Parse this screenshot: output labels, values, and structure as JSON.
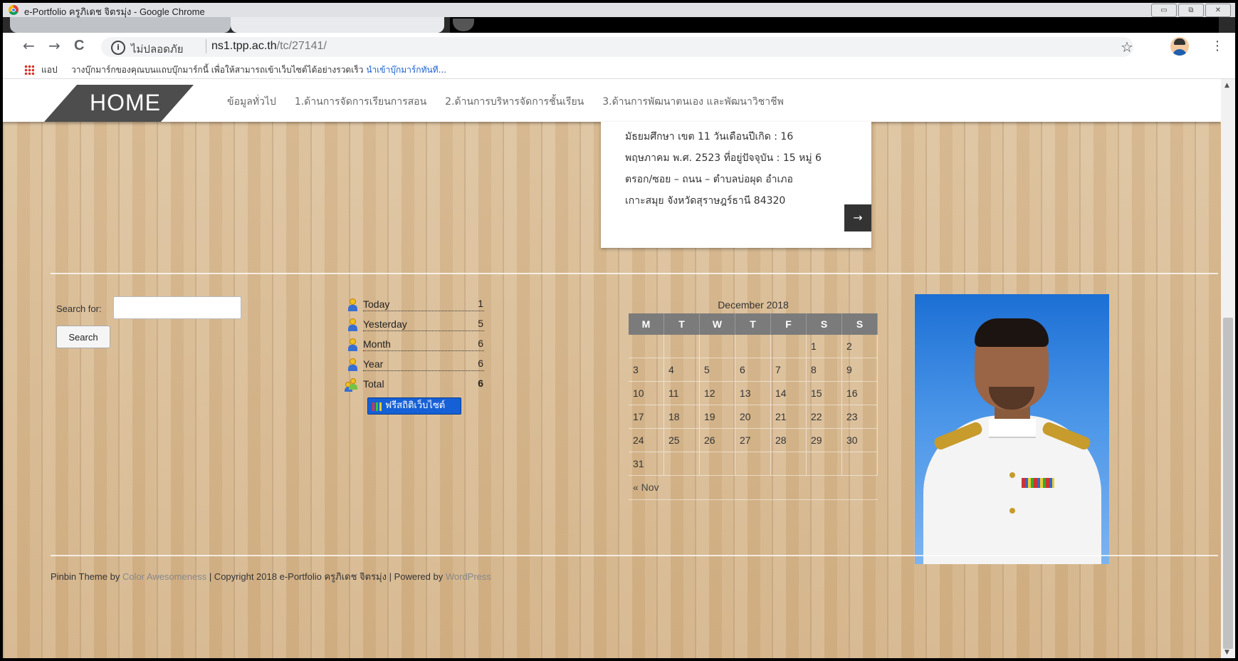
{
  "window": {
    "title": "e-Portfolio ครูภิเดช จิตรมุ่ง - Google Chrome",
    "controls": [
      "▭",
      "⧉",
      "✕"
    ]
  },
  "toolbar": {
    "back": "←",
    "forward": "→",
    "reload": "C",
    "security_label": "ไม่ปลอดภัย",
    "url_host": "ns1.tpp.ac.th",
    "url_path": "/tc/27141/",
    "star": "☆",
    "menu": "⋮"
  },
  "bookmarks": {
    "apps_label": "แอป",
    "prompt_text": "วางบุ๊กมาร์กของคุณบนแถบบุ๊กมาร์กนี้ เพื่อให้สามารถเข้าเว็บไซต์ได้อย่างรวดเร็ว",
    "import_link": "นำเข้าบุ๊กมาร์กทันที..."
  },
  "site_nav": {
    "home": "HOME",
    "items": [
      "ข้อมูลทั่วไป",
      "1.ด้านการจัดการเรียนการสอน",
      "2.ด้านการบริหารจัดการชั้นเรียน",
      "3.ด้านการพัฒนาตนเอง และพัฒนาวิชาชีพ"
    ]
  },
  "post_card": {
    "lines": [
      "มัธยมศึกษา เขต 11 วันเดือนปีเกิด : 16",
      "พฤษภาคม พ.ศ. 2523 ที่อยู่ปัจจุบัน : 15 หมู่ 6",
      "ตรอก/ซอย – ถนน – ตำบลบ่อผุด อำเภอ",
      "เกาะสมุย จังหวัดสุราษฎร์ธานี 84320"
    ],
    "more_arrow": "→"
  },
  "search": {
    "label": "Search for:",
    "value": "",
    "button": "Search"
  },
  "counter": {
    "rows": [
      {
        "label": "Today",
        "value": "1"
      },
      {
        "label": "Yesterday",
        "value": "5"
      },
      {
        "label": "Month",
        "value": "6"
      },
      {
        "label": "Year",
        "value": "6"
      },
      {
        "label": "Total",
        "value": "6"
      }
    ],
    "badge": "ฟรีสถิติเว็บไซต์"
  },
  "calendar": {
    "caption": "December 2018",
    "headers": [
      "M",
      "T",
      "W",
      "T",
      "F",
      "S",
      "S"
    ],
    "weeks": [
      [
        "",
        "",
        "",
        "",
        "",
        "1",
        "2"
      ],
      [
        "3",
        "4",
        "5",
        "6",
        "7",
        "8",
        "9"
      ],
      [
        "10",
        "11",
        "12",
        "13",
        "14",
        "15",
        "16"
      ],
      [
        "17",
        "18",
        "19",
        "20",
        "21",
        "22",
        "23"
      ],
      [
        "24",
        "25",
        "26",
        "27",
        "28",
        "29",
        "30"
      ],
      [
        "31",
        "",
        "",
        "",
        "",
        "",
        ""
      ]
    ],
    "prev_link": "« Nov"
  },
  "footer": {
    "theme": "Pinbin Theme by ",
    "author_link": "Color Awesomeness",
    "copyright": " | Copyright 2018 e-Portfolio ครูภิเดช จิตรมุ่ง | Powered by ",
    "wp_link": "WordPress"
  }
}
